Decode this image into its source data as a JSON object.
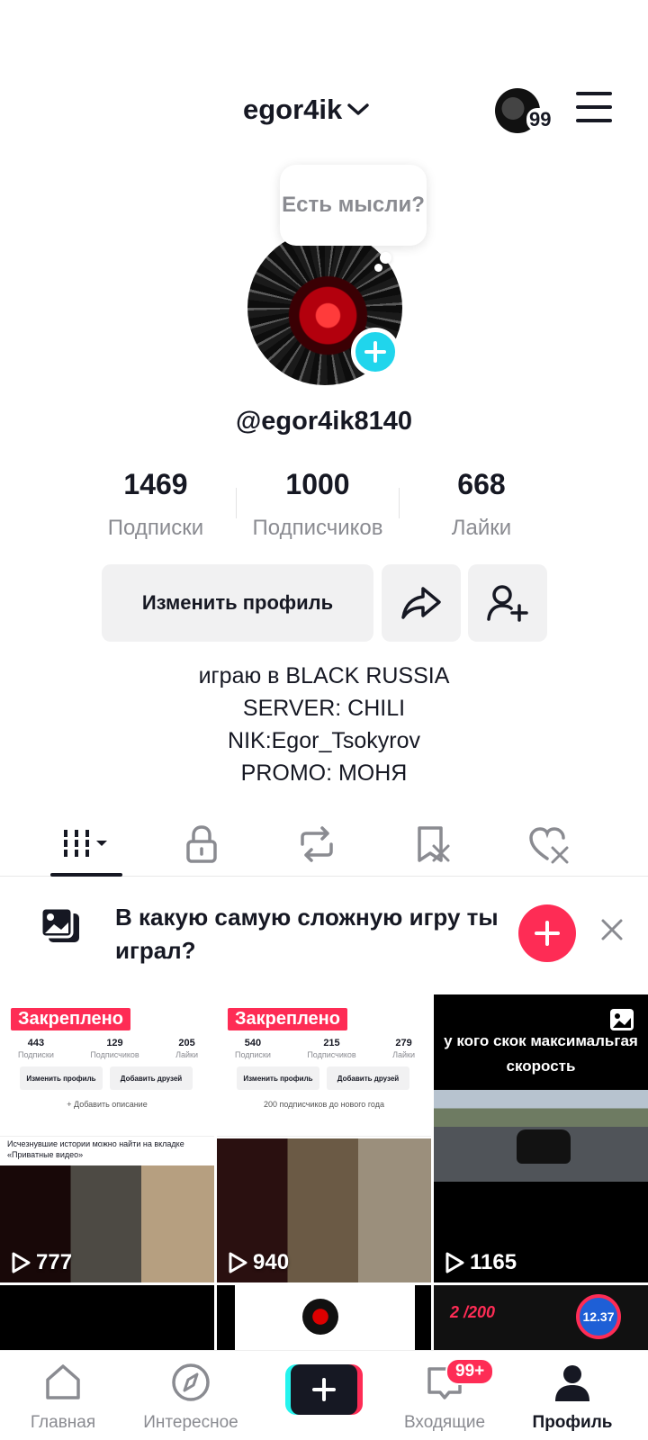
{
  "header": {
    "username": "egor4ik",
    "account_badge": "99"
  },
  "profile": {
    "thought_bubble": "Есть мысли?",
    "handle": "@egor4ik8140",
    "stats": [
      {
        "value": "1469",
        "label": "Подписки"
      },
      {
        "value": "1000",
        "label": "Подписчиков"
      },
      {
        "value": "668",
        "label": "Лайки"
      }
    ],
    "edit_profile_label": "Изменить профиль",
    "bio": [
      "играю в BLACK RUSSIA",
      "SERVER: CHILI",
      "NIK:Egor_Tsokyrov",
      "PROMO: МОНЯ"
    ]
  },
  "tabs": [
    "videos-grid-icon",
    "lock-icon",
    "repost-icon",
    "bookmark-icon",
    "liked-icon"
  ],
  "prompt": {
    "text": "В какую самую сложную игру ты играл?"
  },
  "grid": {
    "pinned_label": "Закреплено",
    "videos": [
      {
        "views": "777",
        "mini_stats": [
          {
            "v": "443",
            "l": "Подписки"
          },
          {
            "v": "129",
            "l": "Подписчиков"
          },
          {
            "v": "205",
            "l": "Лайки"
          }
        ],
        "mini_btn1": "Изменить профиль",
        "mini_btn2": "Добавить друзей",
        "mini_line": "+ Добавить описание",
        "mini_notice": "Исчезнувшие истории можно найти на вкладке «Приватные видео»"
      },
      {
        "views": "940",
        "mini_stats": [
          {
            "v": "540",
            "l": "Подписки"
          },
          {
            "v": "215",
            "l": "Подписчиков"
          },
          {
            "v": "279",
            "l": "Лайки"
          }
        ],
        "mini_btn1": "Изменить профиль",
        "mini_btn2": "Добавить друзей",
        "mini_line": "200 подписчиков до нового года"
      },
      {
        "views": "1165",
        "title": "у кого скок максимальгая скорость"
      },
      {
        "views": ""
      },
      {
        "views": ""
      },
      {
        "views": "",
        "score": "2 /200",
        "badge": "12.37"
      }
    ]
  },
  "bottom_nav": {
    "home": "Главная",
    "discover": "Интересное",
    "inbox": "Входящие",
    "inbox_badge": "99+",
    "profile": "Профиль"
  }
}
